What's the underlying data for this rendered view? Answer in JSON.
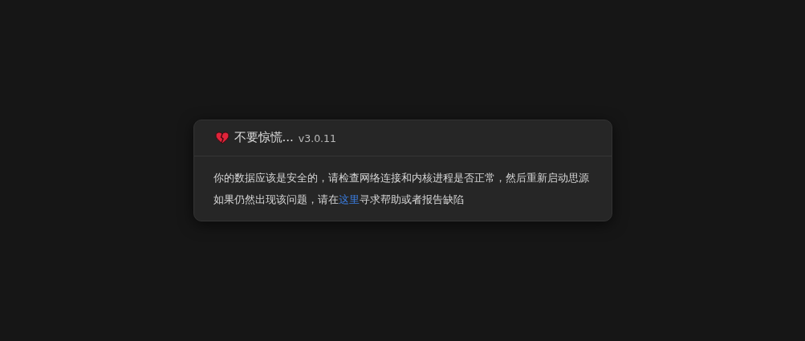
{
  "dialog": {
    "title": "不要惊慌...",
    "version": "v3.0.11",
    "message": "你的数据应该是安全的，请检查网络连接和内核进程是否正常，然后重新启动思源",
    "help": {
      "before": "如果仍然出现该问题，请在",
      "link": "这里",
      "after": "寻求帮助或者报告缺陷"
    }
  }
}
